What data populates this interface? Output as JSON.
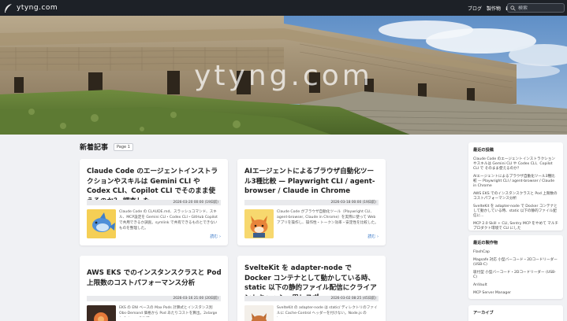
{
  "site": {
    "brand": "ytyng.com",
    "hero_title": "ytyng.com"
  },
  "nav": {
    "links": [
      "ブログ",
      "製作物"
    ],
    "search_placeholder": "検索"
  },
  "main": {
    "section_title": "新着記事",
    "page_badge": "Page 1",
    "cards": [
      {
        "title": "Claude Code のエージェントインストラクションやスキルは Gemini CLI や Codex CLI、Copilot CLI でそのまま使えるのか？ 調査した",
        "date": "2026-03-20 00:00 (19日前)",
        "excerpt": "Claude Code の CLAUDE.md、スラッシュコマンド、スキル、MCP設定を Gemini CLI・Codex CLI・GitHub Copilot で共用できるか調査。symlink で共有できるものとできないものを整理した。",
        "more": "読む"
      },
      {
        "title": "AIエージェントによるブラウザ自動化ツール3種比較 — Playwright CLI / agent-browser / Claude in Chrome",
        "date": "2026-03-18 00:00 (19日前)",
        "excerpt": "Claude Code がブラウザ自動化ツール（Playwright CLI, agent-browser, Claude in Chrome）を実際に使って Web アプリを操作し、操作性・トークン効率・安定性を比較した。",
        "more": "読む"
      },
      {
        "title": "AWS EKS でのインスタンスクラスと Pod 上限数のコストパフォーマンス分析",
        "date": "2026-03-16 21:00 (20日前)",
        "excerpt": "EKS の ENI ベースの Max Pods 計算式とインスタンス別 Obs-Demand 価格から Pod あたりコストを算出。2xlarge と 8xlarge の比較。"
      },
      {
        "title": "SvelteKit を adapter-node で Docker コンテナとして動かしている時、static 以下の静的ファイル配信にクライアントキャッシュ用レスポ...",
        "date": "2026-03-02 08:25 (45日前)",
        "excerpt": "SvelteKit の adapter-node は static/ ディレクトリのファイルに Cache-Control ヘッダーを付けない。Node.js の import"
      }
    ]
  },
  "sidebar": {
    "recent_posts": {
      "title": "最近の投稿",
      "items": [
        "Claude Code のエージェントインストラクションやスキルは Gemini CLI や Codex CLI、Copilot CLI で そのまま使えるのか？",
        "AIエージェントによるブラウザ自動化ツール3種比較 — Playwright CLI / agent-browser / Claude in Chrome",
        "AWS EKS でのインスタンスクラスと Pod 上限数のコストパフォーマンス分析",
        "SvelteKit を adapter-node で Docker コンテナとして動かしている時、static 以下の静的ファイル配信に...",
        "MCP 2.0 Skill + CLI, Sentry MCP をやめて マルチプロダクト環境で CLI にした"
      ]
    },
    "recent_works": {
      "title": "最近の製作物",
      "items": [
        "FlashCap",
        "Magsafe 対応 小型バーコード・2Dコードリーダー (USB-C)",
        "吸付型 小型バーコード・2Dコードリーダー (USB-C)",
        "AnVault",
        "MCP Server Manager"
      ]
    },
    "archive": {
      "title": "アーカイブ"
    }
  },
  "colors": {
    "navbar": "#1d2127",
    "link": "#2c6fc4",
    "background": "#f0f1f4"
  }
}
